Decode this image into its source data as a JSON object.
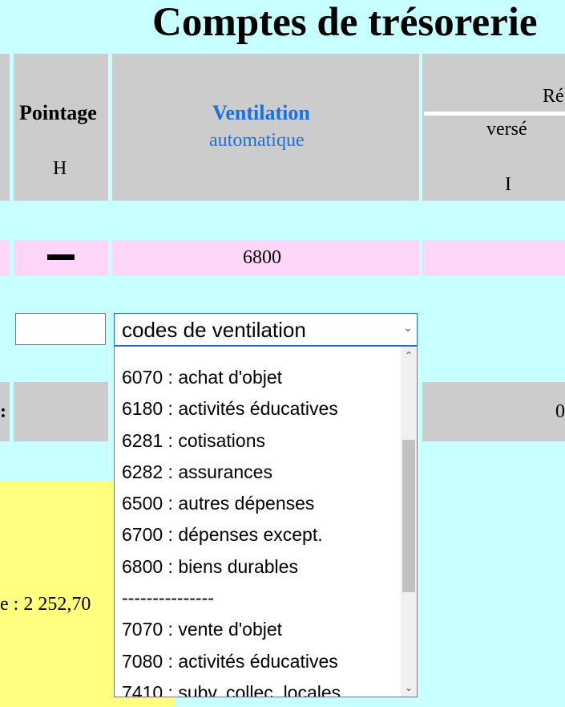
{
  "page": {
    "title": "Comptes de trésorerie"
  },
  "header": {
    "pointage": {
      "label": "Pointage",
      "col": "H"
    },
    "ventilation": {
      "label": "Ventilation",
      "sub": "automatique"
    },
    "reglement": {
      "label_partial": "Ré",
      "sub": "versé",
      "col": "I"
    }
  },
  "row1": {
    "ventilation": "6800"
  },
  "row2": {
    "left_text": ":",
    "reg_value_partial": "0"
  },
  "footer": {
    "total_partial": "e : 2 252,70"
  },
  "select": {
    "value": "codes de ventilation",
    "options": [
      "6070 : achat d'objet",
      "6180 : activités éducatives",
      "6281 : cotisations",
      "6282 : assurances",
      "6500 : autres dépenses",
      "6700 : dépenses except.",
      "6800 : biens durables",
      "---------------",
      "7070 : vente d'objet",
      "7080 : activités éducatives",
      "7410 : subv. collec. locales"
    ]
  },
  "input": {
    "value": ""
  }
}
